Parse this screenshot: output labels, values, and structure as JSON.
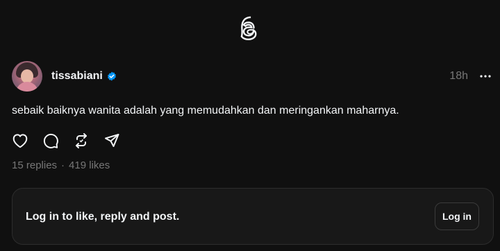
{
  "header": {
    "logo_icon": "threads-logo-icon"
  },
  "post": {
    "username": "tissabiani",
    "verified_icon": "verified-badge-icon",
    "time": "18h",
    "more_icon": "more-horizontal-icon",
    "text": "sebaik baiknya wanita adalah yang memudahkan dan meringankan maharnya.",
    "actions": [
      {
        "name": "like",
        "icon": "heart-icon"
      },
      {
        "name": "reply",
        "icon": "comment-icon"
      },
      {
        "name": "repost",
        "icon": "repost-icon"
      },
      {
        "name": "share",
        "icon": "send-icon"
      }
    ],
    "stats": {
      "replies": "15 replies",
      "separator": "·",
      "likes": "419 likes"
    }
  },
  "login_prompt": {
    "text": "Log in to like, reply and post.",
    "button_label": "Log in"
  },
  "colors": {
    "background": "#101010",
    "card": "#181818",
    "text": "#f3f5f7",
    "muted": "#777777",
    "verified": "#0095f6"
  }
}
